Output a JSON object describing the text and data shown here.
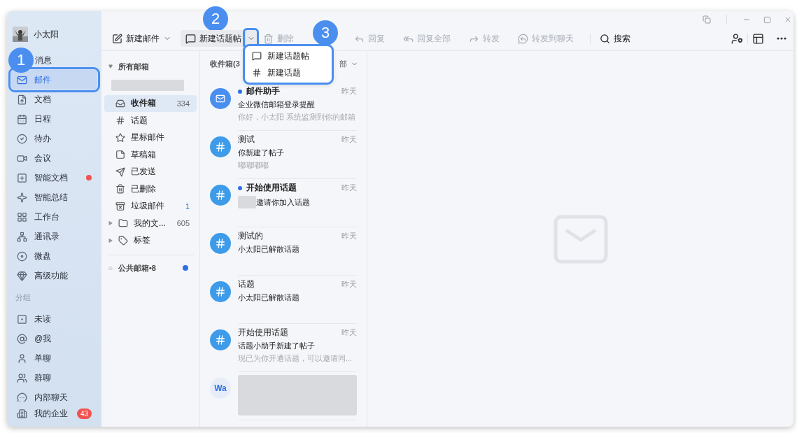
{
  "sidebar": {
    "user": {
      "name": "小太阳"
    },
    "nav": [
      {
        "label": "消息",
        "selected": false,
        "callout": "1"
      },
      {
        "label": "邮件",
        "selected": true,
        "highlighted": true
      },
      {
        "label": "文档",
        "selected": false
      },
      {
        "label": "日程",
        "selected": false
      },
      {
        "label": "待办",
        "selected": false
      },
      {
        "label": "会议",
        "selected": false
      },
      {
        "label": "智能文档",
        "selected": false,
        "dot": true
      },
      {
        "label": "智能总结",
        "selected": false
      },
      {
        "label": "工作台",
        "selected": false
      },
      {
        "label": "通讯录",
        "selected": false
      },
      {
        "label": "微盘",
        "selected": false
      },
      {
        "label": "高级功能",
        "selected": false
      }
    ],
    "group_heading": "分组",
    "groups": [
      {
        "label": "未读"
      },
      {
        "label": "@我"
      },
      {
        "label": "单聊"
      },
      {
        "label": "群聊"
      },
      {
        "label": "内部聊天"
      }
    ],
    "footer": {
      "label": "我的企业",
      "badge": "43"
    }
  },
  "toolbar": {
    "buttons": [
      {
        "label": "新建邮件",
        "disabled": false,
        "kind": "menu"
      },
      {
        "label": "新建话题帖",
        "disabled": false,
        "kind": "split",
        "callout": "2",
        "highlighted": true
      },
      {
        "label": "删除",
        "disabled": true,
        "kind": "plain"
      },
      {
        "label": "3",
        "kind": "callout"
      },
      {
        "label": "回复",
        "disabled": true,
        "kind": "plain"
      },
      {
        "label": "回复全部",
        "disabled": true,
        "kind": "plain"
      },
      {
        "label": "转发",
        "disabled": true,
        "kind": "plain"
      },
      {
        "label": "转发到聊天",
        "disabled": true,
        "kind": "plain"
      }
    ],
    "search": "搜索"
  },
  "dropdown": {
    "highlighted": true,
    "items": [
      {
        "label": "新建话题帖"
      },
      {
        "label": "新建话题"
      }
    ]
  },
  "folders": {
    "heading": "所有邮箱",
    "expanded": true,
    "items": [
      {
        "label": "收件箱",
        "count": "334",
        "selected": true,
        "unread": false
      },
      {
        "label": "话题",
        "selected": false
      },
      {
        "label": "星标邮件",
        "selected": false
      },
      {
        "label": "草稿箱",
        "selected": false
      },
      {
        "label": "已发送",
        "selected": false
      },
      {
        "label": "已删除",
        "selected": false
      },
      {
        "label": "垃圾邮件",
        "count": "1",
        "selected": false,
        "unread": true
      },
      {
        "label": "我的文...",
        "count": "605",
        "selected": false,
        "expandable": true
      },
      {
        "label": "标签",
        "selected": false,
        "expandable": true
      }
    ],
    "public": {
      "label": "公共邮箱•8",
      "dot": true
    }
  },
  "message_list": {
    "title": "收件箱(3",
    "filter": "部",
    "messages": [
      {
        "kind": "mail",
        "sender": "邮件助手",
        "unread": true,
        "time": "昨天",
        "subject": "企业微信邮箱登录提醒",
        "preview": "你好，小太阳 系统监测到你的邮箱"
      },
      {
        "kind": "topic",
        "sender": "测试",
        "unread": false,
        "time": "昨天",
        "subject": "你新建了帖子",
        "preview": "嘟嘟嘟嘟"
      },
      {
        "kind": "topic",
        "sender": "开始使用话题",
        "unread": true,
        "time": "昨天",
        "subject": "邀请你加入话题",
        "redacted": true
      },
      {
        "kind": "topic",
        "sender": "测试的",
        "unread": false,
        "time": "昨天",
        "subject": "小太阳已解散话题"
      },
      {
        "kind": "topic",
        "sender": "话题",
        "unread": false,
        "time": "昨天",
        "subject": "小太阳已解散话题"
      },
      {
        "kind": "topic",
        "sender": "开始使用话题",
        "unread": false,
        "time": "昨天",
        "subject": "话题小助手新建了帖子",
        "preview": "现已为你开通话题，可以邀请同..."
      },
      {
        "kind": "initials",
        "initials": "Wa",
        "redacted": true
      }
    ]
  }
}
